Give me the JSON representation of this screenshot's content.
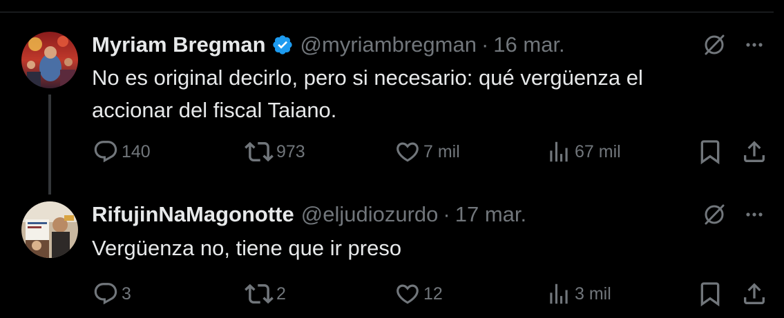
{
  "colors": {
    "background": "#000000",
    "text_primary": "#e7e9ea",
    "text_secondary": "#71767b",
    "verified_badge": "#1d9bf0",
    "thread_line": "#333639"
  },
  "tweets": [
    {
      "display_name": "Myriam Bregman",
      "verified": true,
      "handle": "@myriambregman",
      "separator": "·",
      "date": "16 mar.",
      "text": "No es original decirlo, pero si necesario: qué vergüenza el accionar del fiscal Taiano.",
      "replies": "140",
      "reposts": "973",
      "likes": "7 mil",
      "views": "67 mil"
    },
    {
      "display_name": "RifujinNaMagonotte",
      "verified": false,
      "handle": "@eljudiozurdo",
      "separator": "·",
      "date": "17 mar.",
      "text": "Vergüenza no, tiene que ir preso",
      "replies": "3",
      "reposts": "2",
      "likes": "12",
      "views": "3 mil"
    }
  ],
  "icons": {
    "reply": "reply-icon",
    "repost": "repost-icon",
    "like": "heart-icon",
    "views": "views-icon",
    "bookmark": "bookmark-icon",
    "share": "share-icon",
    "grok": "grok-icon",
    "more": "more-icon",
    "verified": "verified-badge-icon"
  }
}
